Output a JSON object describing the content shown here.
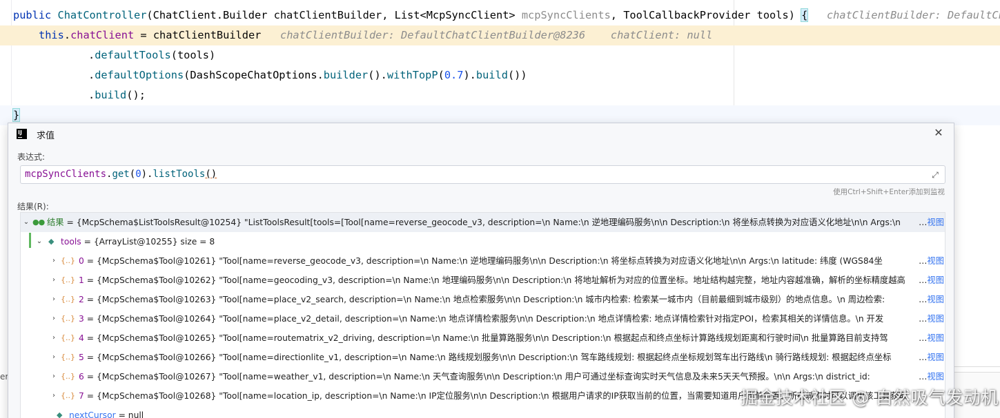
{
  "code": {
    "line1": {
      "kw": "public",
      "name": "ChatController",
      "p1_type": "ChatClient.Builder",
      "p1_name": "chatClientBuilder",
      "p2_type": "List",
      "p2_generic": "McpSyncClient",
      "p2_name": "mcpSyncClients",
      "p3_type": "ToolCallbackProvider",
      "p3_name": "tools",
      "brace": "{",
      "hint": "chatClientBuilder: DefaultChatC"
    },
    "line2": {
      "this": "this",
      "field": "chatClient",
      "rhs": "chatClientBuilder",
      "hint1": "chatClientBuilder: DefaultChatClientBuilder@8236",
      "hint2": "chatClient: null"
    },
    "line3": {
      "method": "defaultTools",
      "arg": "tools"
    },
    "line4": {
      "method": "defaultOptions",
      "cls": "DashScopeChatOptions",
      "m1": "builder",
      "m2": "withTopP",
      "num": "0.7",
      "m3": "build"
    },
    "line5": {
      "method": "build"
    },
    "line6": {
      "brace": "}"
    }
  },
  "dialog": {
    "title": "求值",
    "expression_label": "表达式:",
    "expression": {
      "obj": "mcpSyncClients",
      "m1": "get",
      "arg": "0",
      "m2": "listTools"
    },
    "watch_hint": "使用Ctrl+Shift+Enter添加到监视",
    "result_label": "结果(R):",
    "view_link": "视图"
  },
  "tree": {
    "result": {
      "name": "结果",
      "value": "= {McpSchema$ListToolsResult@10254} \"ListToolsResult[tools=[Tool[name=reverse_geocode_v3, description=\\n     Name:\\n        逆地理编码服务\\n\\n      Description:\\n        将坐标点转换为对应语义化地址\\n\\n      Args:\\n   "
    },
    "tools": {
      "name": "tools",
      "value": "= {ArrayList@10255}  size = 8"
    },
    "items": [
      {
        "index": "0",
        "value": "= {McpSchema$Tool@10261} \"Tool[name=reverse_geocode_v3, description=\\n     Name:\\n        逆地理编码服务\\n\\n      Description:\\n        将坐标点转换为对应语义化地址\\n\\n      Args:\\n        latitude: 纬度 (WGS84坐"
      },
      {
        "index": "1",
        "value": "= {McpSchema$Tool@10262} \"Tool[name=geocoding_v3, description=\\n     Name:\\n        地理编码服务\\n\\n      Description:\\n        将地址解析为对应的位置坐标。地址结构越完整，地址内容越准确，解析的坐标精度越高"
      },
      {
        "index": "2",
        "value": "= {McpSchema$Tool@10263} \"Tool[name=place_v2_search, description=\\n     Name:\\n        地点检索服务\\n\\n      Description:\\n        城市内检索: 检索某一城市内（目前最细到城市级别）的地点信息。\\n        周边检索: "
      },
      {
        "index": "3",
        "value": "= {McpSchema$Tool@10264} \"Tool[name=place_v2_detail, description=\\n     Name:\\n        地点详情检索服务\\n\\n      Description:\\n        地点详情检索: 地点详情检索针对指定POI，检索其相关的详情信息。\\n        开发"
      },
      {
        "index": "4",
        "value": "= {McpSchema$Tool@10265} \"Tool[name=routematrix_v2_driving, description=\\n     Name:\\n        批量算路服务\\n\\n      Description:\\n        根据起点和终点坐标计算路线规划距离和行驶时间\\n        批量算路目前支持驾"
      },
      {
        "index": "5",
        "value": "= {McpSchema$Tool@10266} \"Tool[name=directionlite_v1, description=\\n     Name:\\n        路线规划服务\\n\\n      Description:\\n        驾车路线规划: 根据起终点坐标规划驾车出行路线\\n        骑行路线规划: 根据起终点坐标"
      },
      {
        "index": "6",
        "value": "= {McpSchema$Tool@10267} \"Tool[name=weather_v1, description=\\n     Name:\\n        天气查询服务\\n\\n      Description:\\n        用户可通过坐标查询实时天气信息及未来5天天气预报。\\n\\n      Args:\\n        district_id: "
      },
      {
        "index": "7",
        "value": "= {McpSchema$Tool@10268} \"Tool[name=location_ip, description=\\n     Name:\\n        IP定位服务\\n\\n      Description:\\n        根据用户请求的IP获取当前的位置，当需要知道用户当前位置、所在城市时可以调用该工具获取"
      }
    ],
    "next_cursor": {
      "name": "nextCursor",
      "value": "= null"
    }
  },
  "watermark": "掘金技术社区 @ 自然吸气发动机"
}
